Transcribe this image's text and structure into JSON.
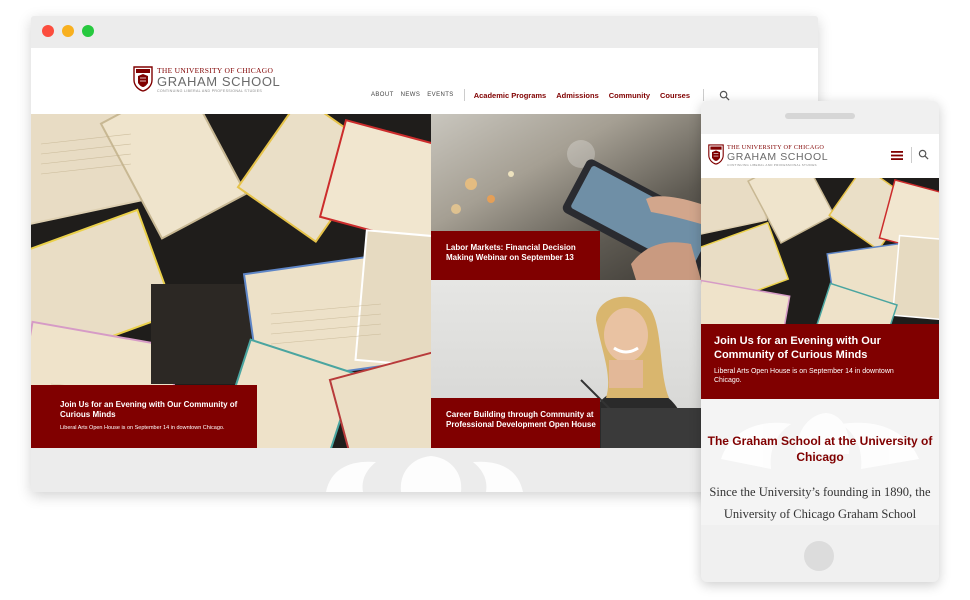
{
  "desktop": {
    "logo": {
      "university": "THE UNIVERSITY OF CHICAGO",
      "school": "GRAHAM SCHOOL",
      "tagline": "CONTINUING LIBERAL AND PROFESSIONAL STUDIES"
    },
    "nav": {
      "secondary": [
        "ABOUT",
        "NEWS",
        "EVENTS"
      ],
      "primary": [
        "Academic Programs",
        "Admissions",
        "Community",
        "Courses"
      ]
    },
    "hero": {
      "main": {
        "title": "Join Us for an Evening with Our Community of Curious Minds",
        "subtitle": "Liberal Arts Open House is on September 14 in downtown Chicago."
      },
      "top_right": {
        "title": "Labor Markets: Financial Decision Making Webinar on September 13"
      },
      "bottom_right": {
        "title": "Career Building through Community at Professional Development Open House"
      }
    }
  },
  "mobile": {
    "logo": {
      "university": "THE UNIVERSITY OF CHICAGO",
      "school": "GRAHAM SCHOOL",
      "tagline": "CONTINUING LIBERAL AND PROFESSIONAL STUDIES"
    },
    "hero": {
      "title": "Join Us for an Evening with Our Community of Curious Minds",
      "subtitle": "Liberal Arts Open House is on September 14 in downtown Chicago."
    },
    "section": {
      "heading": "The Graham School at the University of Chicago",
      "body": "Since the University’s founding in 1890, the University of Chicago Graham School"
    }
  },
  "icons": {
    "search": "search-icon",
    "menu": "hamburger-menu-icon",
    "shield": "university-shield-icon"
  },
  "colors": {
    "brand_maroon": "#800000",
    "window_close": "#fc4d3e",
    "window_minimize": "#f8b01f",
    "window_maximize": "#27c93f"
  }
}
